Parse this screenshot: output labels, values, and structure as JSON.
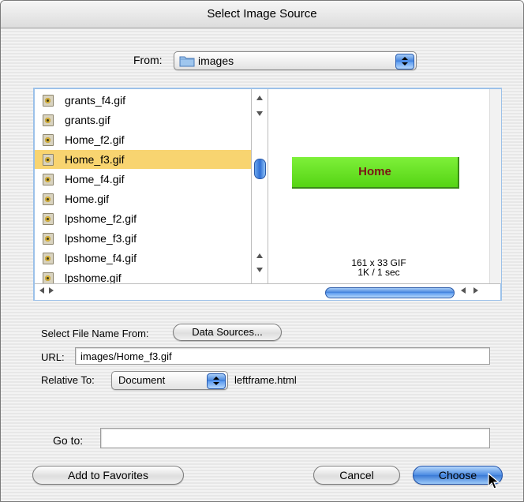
{
  "window": {
    "title": "Select Image Source"
  },
  "from": {
    "label": "From:",
    "folder": "images",
    "folder_icon": "folder-icon"
  },
  "files": [
    {
      "name": "grants_f4.gif",
      "selected": false
    },
    {
      "name": "grants.gif",
      "selected": false
    },
    {
      "name": "Home_f2.gif",
      "selected": false
    },
    {
      "name": "Home_f3.gif",
      "selected": true
    },
    {
      "name": "Home_f4.gif",
      "selected": false
    },
    {
      "name": "Home.gif",
      "selected": false
    },
    {
      "name": "lpshome_f2.gif",
      "selected": false
    },
    {
      "name": "lpshome_f3.gif",
      "selected": false
    },
    {
      "name": "lpshome_f4.gif",
      "selected": false
    },
    {
      "name": "lpshome.gif",
      "selected": false
    }
  ],
  "preview": {
    "image_text": "Home",
    "image_color": "#66e02a",
    "image_text_color": "#7a1515",
    "dimensions": "161 x 33 GIF",
    "size": "1K / 1 sec"
  },
  "select_file_name": {
    "label": "Select File Name From:",
    "button": "Data Sources..."
  },
  "url": {
    "label": "URL:",
    "value": "images/Home_f3.gif"
  },
  "relative_to": {
    "label": "Relative To:",
    "value": "Document",
    "file": "leftframe.html"
  },
  "goto": {
    "label": "Go to:",
    "value": ""
  },
  "buttons": {
    "add_favorites": "Add to Favorites",
    "cancel": "Cancel",
    "choose": "Choose"
  },
  "colors": {
    "selection": "#f8d470",
    "accent": "#3d7fdc"
  }
}
